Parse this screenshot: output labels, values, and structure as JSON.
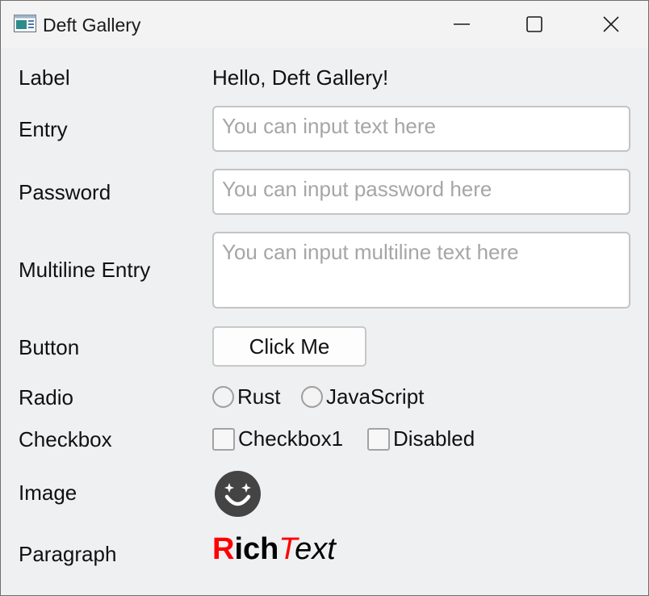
{
  "window": {
    "title": "Deft Gallery"
  },
  "rows": {
    "label": {
      "name": "Label",
      "value": "Hello, Deft Gallery!"
    },
    "entry": {
      "name": "Entry",
      "placeholder": "You can input text here"
    },
    "password": {
      "name": "Password",
      "placeholder": "You can input password here"
    },
    "multiline": {
      "name": "Multiline Entry",
      "placeholder": "You can input multiline text here"
    },
    "button": {
      "name": "Button",
      "label": "Click Me"
    },
    "radio": {
      "name": "Radio",
      "options": [
        "Rust",
        "JavaScript"
      ]
    },
    "checkbox": {
      "name": "Checkbox",
      "options": [
        "Checkbox1",
        "Disabled"
      ]
    },
    "image": {
      "name": "Image",
      "icon": "smiley-face-icon"
    },
    "paragraph": {
      "name": "Paragraph",
      "parts": [
        "R",
        "ich",
        "T",
        "ext"
      ]
    }
  },
  "colors": {
    "accent_red": "#ff0000",
    "background": "#eff0f2",
    "icon_dark": "#444444"
  }
}
